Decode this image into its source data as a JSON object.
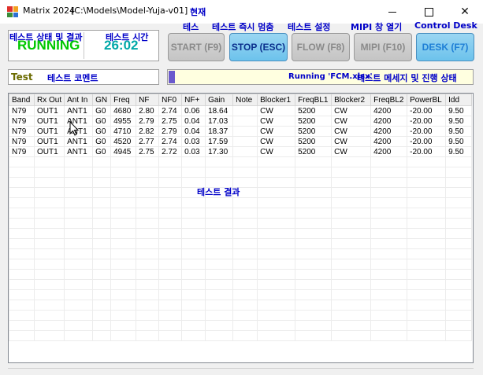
{
  "window": {
    "title": "Matrix 2024",
    "path": "[C:\\Models\\Model-Yuja-v01]",
    "current_anno": "현재"
  },
  "annotations": {
    "test_label": "테스",
    "test_stop": "테스트 즉시 멈춤",
    "test_setting": "테스트 설정",
    "mipi_open": "MIPI 창 열기",
    "control_desk": "Control Desk",
    "test_comment": "테스트 코멘트",
    "test_message": "테스트 메세지 및 진행 상태",
    "test_result": "테스트 결과"
  },
  "status": {
    "state_label": "테스트 상태 및 결과",
    "state_value": "RUNNING",
    "time_label": "테스트 시간",
    "time_value": "26:02",
    "state_color": "#00c800",
    "time_color": "#00a8a8"
  },
  "toolbar": {
    "start_label": "START (F9)",
    "stop_label": "STOP (ESC)",
    "flow_label": "FLOW (F8)",
    "mipi_label": "MIPI (F10)",
    "desk_label": "DESK (F7)"
  },
  "comment": {
    "tag": "Test"
  },
  "message": {
    "text": "Running 'FCM.xlsx'"
  },
  "table": {
    "columns": [
      "Band",
      "Rx Out",
      "Ant In",
      "GN",
      "Freq",
      "NF",
      "NF0",
      "NF+",
      "Gain",
      "Note",
      "Blocker1",
      "FreqBL1",
      "Blocker2",
      "FreqBL2",
      "PowerBL",
      "Idd"
    ],
    "rows": [
      [
        "N79",
        "OUT1",
        "ANT1",
        "G0",
        "4680",
        "2.80",
        "2.74",
        "0.06",
        "18.64",
        "",
        "CW",
        "5200",
        "CW",
        "4200",
        "-20.00",
        "9.50"
      ],
      [
        "N79",
        "OUT1",
        "ANT1",
        "G0",
        "4955",
        "2.79",
        "2.75",
        "0.04",
        "17.03",
        "",
        "CW",
        "5200",
        "CW",
        "4200",
        "-20.00",
        "9.50"
      ],
      [
        "N79",
        "OUT1",
        "ANT1",
        "G0",
        "4710",
        "2.82",
        "2.79",
        "0.04",
        "18.37",
        "",
        "CW",
        "5200",
        "CW",
        "4200",
        "-20.00",
        "9.50"
      ],
      [
        "N79",
        "OUT1",
        "ANT1",
        "G0",
        "4520",
        "2.77",
        "2.74",
        "0.03",
        "17.59",
        "",
        "CW",
        "5200",
        "CW",
        "4200",
        "-20.00",
        "9.50"
      ],
      [
        "N79",
        "OUT1",
        "ANT1",
        "G0",
        "4945",
        "2.75",
        "2.72",
        "0.03",
        "17.30",
        "",
        "CW",
        "5200",
        "CW",
        "4200",
        "-20.00",
        "9.50"
      ]
    ]
  },
  "icons": {
    "app": "matrix-app-icon",
    "minimize": "minimize-icon",
    "maximize": "maximize-icon",
    "close": "close-icon",
    "cursor": "mouse-pointer-icon"
  }
}
